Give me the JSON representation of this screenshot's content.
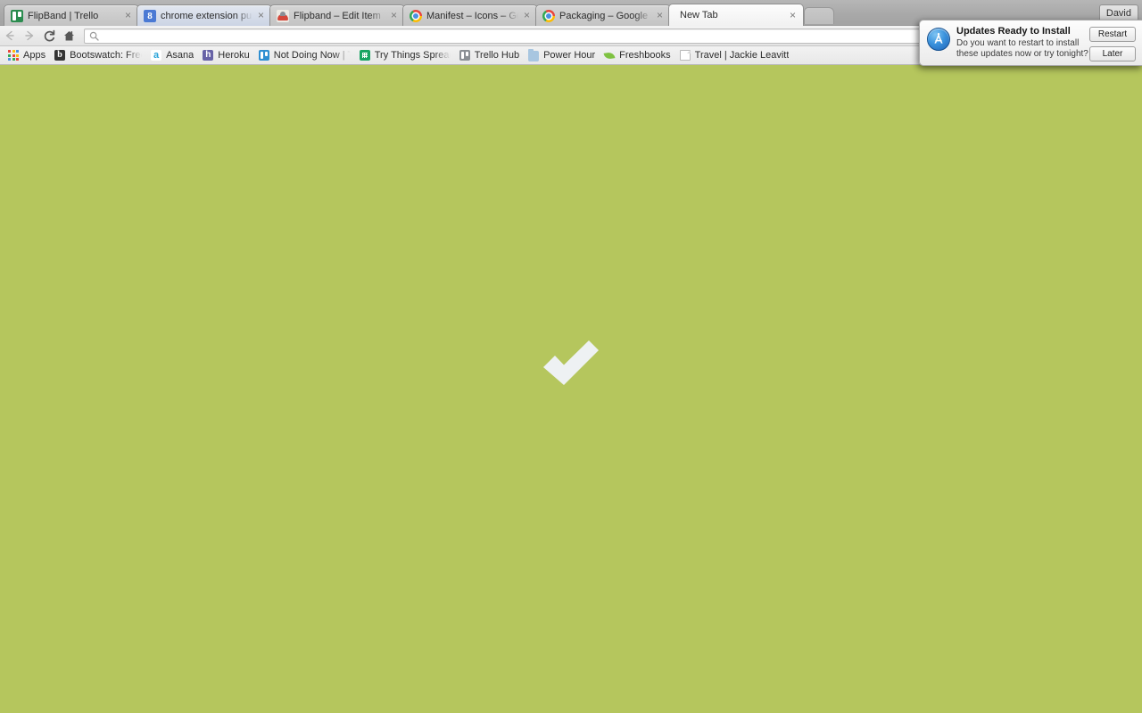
{
  "window": {
    "profile_label": "David",
    "page_background_color": "#b5c65d"
  },
  "tabstrip": {
    "tabs": [
      {
        "title": "FlipBand | Trello",
        "favicon": "trello-favicon",
        "state": "inactive",
        "close_label": "×"
      },
      {
        "title": "chrome extension publish",
        "favicon": "google-blue-favicon",
        "state": "hovered",
        "close_label": "×"
      },
      {
        "title": "Flipband – Edit Item",
        "favicon": "flipband-favicon",
        "state": "inactive",
        "close_label": "×"
      },
      {
        "title": "Manifest – Icons – Google",
        "favicon": "chrome-favicon",
        "state": "inactive",
        "close_label": "×"
      },
      {
        "title": "Packaging – Google Chrome",
        "favicon": "chrome-favicon",
        "state": "inactive",
        "close_label": "×"
      },
      {
        "title": "New Tab",
        "favicon": "none",
        "state": "active",
        "close_label": "×"
      }
    ],
    "new_tab_button_name": "new-tab-button"
  },
  "toolbar": {
    "back_icon": "back-arrow-icon",
    "forward_icon": "forward-arrow-icon",
    "reload_icon": "reload-icon",
    "home_icon": "home-icon",
    "omnibox": {
      "value": "",
      "placeholder": "",
      "search_icon": "search-icon"
    },
    "menu_icon": "chrome-menu-icon"
  },
  "bookmarks": {
    "apps_label": "Apps",
    "items": [
      {
        "label": "Bootswatch: Free themes for Bootstrap",
        "icon": "bootswatch-icon"
      },
      {
        "label": "Asana",
        "icon": "asana-icon"
      },
      {
        "label": "Heroku",
        "icon": "heroku-icon"
      },
      {
        "label": "Not Doing Now | Trello",
        "icon": "trello-icon"
      },
      {
        "label": "Try Things Spreadsheet",
        "icon": "google-sheets-icon"
      },
      {
        "label": "Trello Hub",
        "icon": "trello-hub-icon"
      },
      {
        "label": "Power Hour",
        "icon": "folder-icon"
      },
      {
        "label": "Freshbooks",
        "icon": "leaf-icon"
      },
      {
        "label": "Travel | Jackie Leavitt",
        "icon": "document-icon"
      }
    ]
  },
  "page": {
    "content_icon": "checkmark-icon",
    "checkmark_color": "#eef1f3"
  },
  "notification": {
    "app_icon": "app-store-icon",
    "title": "Updates Ready to Install",
    "body_line_1": "Do you want to restart to install",
    "body_line_2": "these updates now or try tonight?",
    "primary_button": "Restart",
    "secondary_button": "Later"
  }
}
